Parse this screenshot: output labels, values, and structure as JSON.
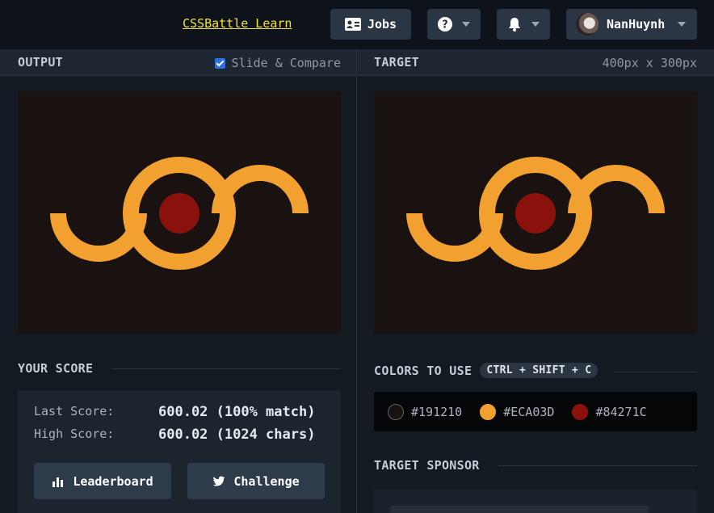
{
  "topbar": {
    "learn_link": "CSSBattle Learn",
    "jobs_label": "Jobs",
    "username": "NanHuynh"
  },
  "output_panel": {
    "title": "OUTPUT",
    "slide_compare_label": "Slide & Compare",
    "slide_compare_checked": true
  },
  "target_panel": {
    "title": "TARGET",
    "dimensions": "400px x 300px"
  },
  "score": {
    "title": "YOUR SCORE",
    "last_label": "Last Score:",
    "last_value": "600.02 (100% match)",
    "high_label": "High Score:",
    "high_value": "600.02 (1024 chars)",
    "leaderboard_label": "Leaderboard",
    "challenge_label": "Challenge"
  },
  "colors": {
    "title": "COLORS TO USE",
    "shortcut": "CTRL + SHIFT + C",
    "items": [
      {
        "hex": "#191210",
        "label": "#191210"
      },
      {
        "hex": "#ECA03D",
        "label": "#ECA03D"
      },
      {
        "hex": "#84271C",
        "label": "#84271C"
      }
    ]
  },
  "sponsor": {
    "title": "TARGET SPONSOR"
  },
  "art_colors": {
    "background": "#191210",
    "ring": "#F2A030",
    "center": "#8B120C"
  },
  "icons": [
    "id-card-icon",
    "question-circle-icon",
    "bell-icon",
    "chevron-down-icon",
    "bar-chart-icon",
    "twitter-icon"
  ]
}
